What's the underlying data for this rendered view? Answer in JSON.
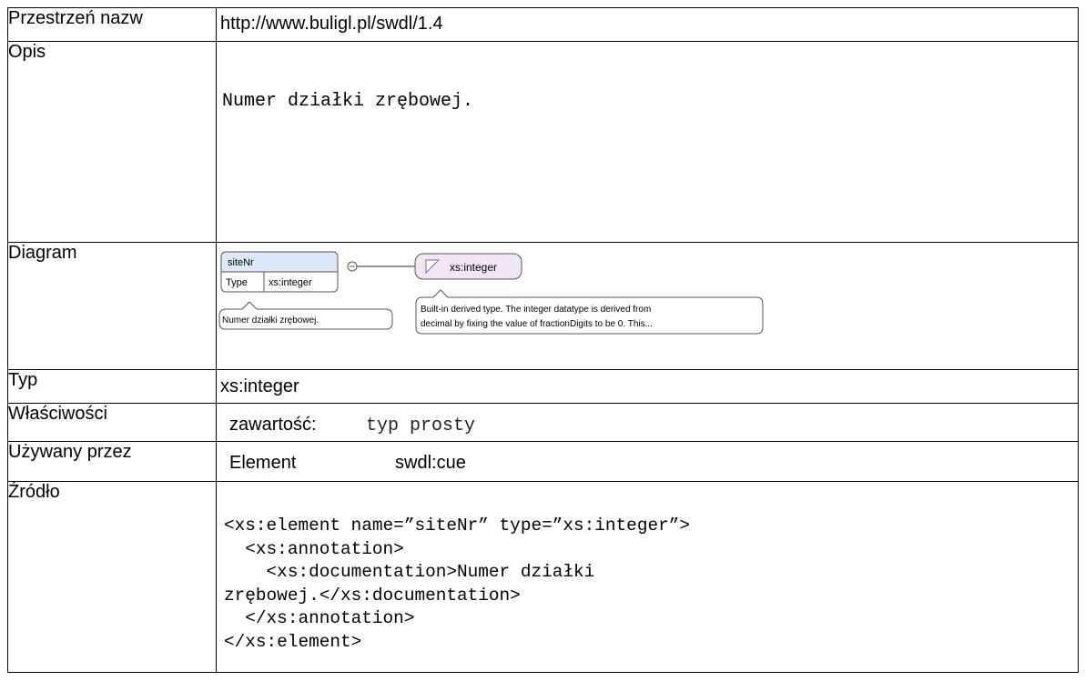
{
  "rows": {
    "namespace": {
      "label": "Przestrzeń nazw",
      "value": "http://www.buligl.pl/swdl/1.4"
    },
    "description": {
      "label": "Opis",
      "value": "Numer działki zrębowej."
    },
    "diagram": {
      "label": "Diagram",
      "element_name": "siteNr",
      "type_key": "Type",
      "type_value": "xs:integer",
      "element_doc": "Numer działki zrębowej.",
      "simple_type_name": "xs:integer",
      "simple_type_doc_line1": "Built-in derived type. The integer datatype is derived from",
      "simple_type_doc_line2": "decimal by fixing the value of fractionDigits to be 0. This...",
      "colors": {
        "header_fill": "#dde8fb",
        "type_fill": "#f1e6f6",
        "stroke": "#555555"
      }
    },
    "type": {
      "label": "Typ",
      "value": "xs:integer"
    },
    "properties": {
      "label": "Właściwości",
      "key": "zawartość:",
      "value": "typ prosty"
    },
    "used_by": {
      "label": "Używany przez",
      "kind": "Element",
      "name": "swdl:cue"
    },
    "source": {
      "label": "Źródło",
      "code": "<xs:element name=”siteNr” type=”xs:integer”>\n  <xs:annotation>\n    <xs:documentation>Numer działki\nzrębowej.</xs:documentation>\n  </xs:annotation>\n</xs:element>"
    }
  }
}
